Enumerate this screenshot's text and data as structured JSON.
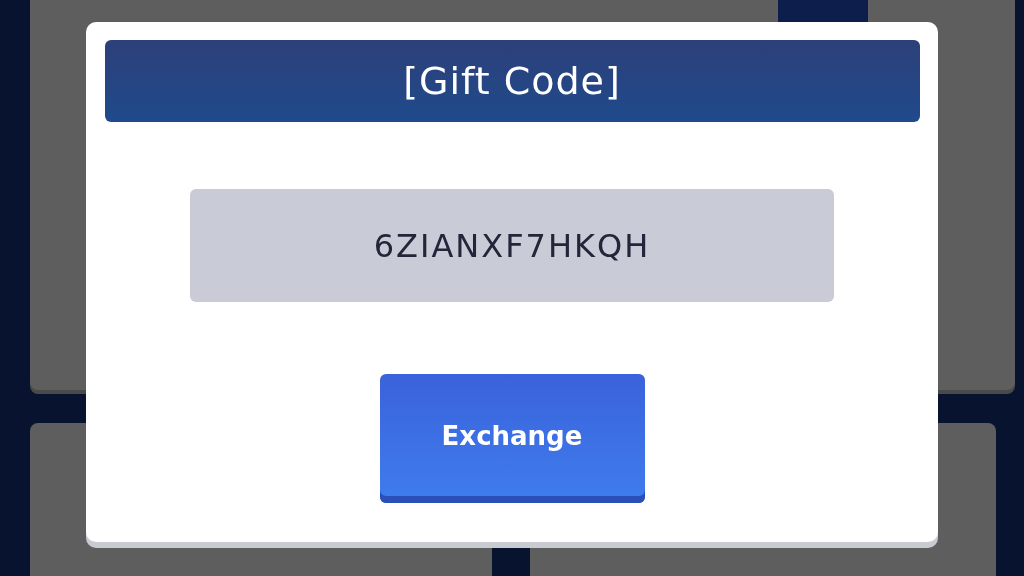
{
  "dialog": {
    "title": "[Gift Code]",
    "code": "6ZIANXF7HKQH",
    "button": "Exchange"
  }
}
